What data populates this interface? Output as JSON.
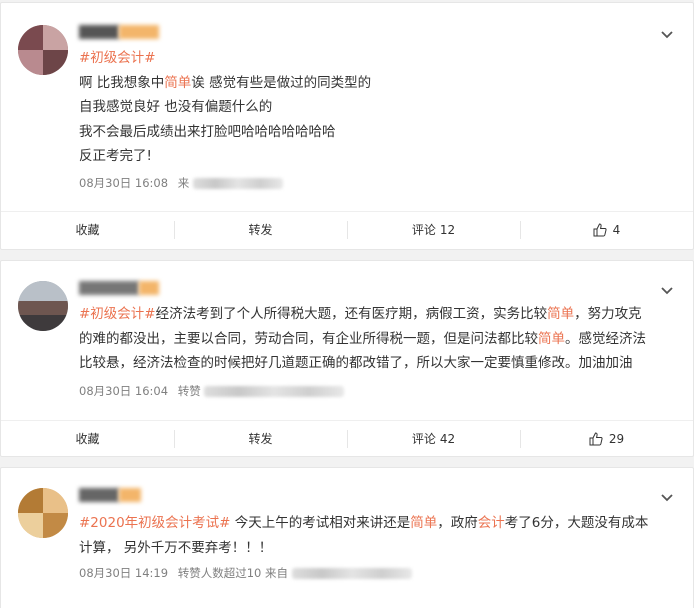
{
  "posts": [
    {
      "user": {
        "name": "",
        "avatar": "avatar-image"
      },
      "lines": [
        [
          {
            "t": "#初级会计#",
            "c": "tag"
          }
        ],
        [
          {
            "t": "啊 比我想象中"
          },
          {
            "t": "简单",
            "c": "hl"
          },
          {
            "t": "诶 感觉有些是做过的同类型的"
          }
        ],
        [
          {
            "t": "自我感觉良好 也没有偏题什么的"
          }
        ],
        [
          {
            "t": "我不会最后成绩出来打脸吧哈哈哈哈哈哈哈"
          }
        ],
        [
          {
            "t": "反正考完了!"
          }
        ]
      ],
      "time": "08月30日 16:08",
      "source_prefix": "来",
      "actions": {
        "collect": "收藏",
        "repost": "转发",
        "comment_label": "评论",
        "comment_count": "12",
        "like_count": "4"
      }
    },
    {
      "user": {
        "name": "",
        "avatar": "avatar-image"
      },
      "lines": [
        [
          {
            "t": "#初级会计#",
            "c": "tag"
          },
          {
            "t": "经济法考到了个人所得税大题，还有医疗期，病假工资，实务比较"
          },
          {
            "t": "简单",
            "c": "hl"
          },
          {
            "t": "，努力攻克"
          }
        ],
        [
          {
            "t": "的难的都没出，主要以合同，劳动合同，有企业所得税一题，但是问法都比较"
          },
          {
            "t": "简单",
            "c": "hl"
          },
          {
            "t": "。感觉经济法"
          }
        ],
        [
          {
            "t": "比较悬，经济法检查的时候把好几道题正确的都改错了，所以大家一定要慎重修改。加油加油"
          }
        ]
      ],
      "time": "08月30日 16:04",
      "source_prefix": "转赞",
      "actions": {
        "collect": "收藏",
        "repost": "转发",
        "comment_label": "评论",
        "comment_count": "42",
        "like_count": "29"
      }
    },
    {
      "user": {
        "name": "",
        "avatar": "avatar-image"
      },
      "lines": [
        [
          {
            "t": "#2020年初级会计考试#",
            "c": "tag"
          },
          {
            "t": " 今天上午的考试相对来讲还是"
          },
          {
            "t": "简单",
            "c": "hl"
          },
          {
            "t": "，政府"
          },
          {
            "t": "会计",
            "c": "hl"
          },
          {
            "t": "考了6分，大题没有成本"
          }
        ],
        [
          {
            "t": "计算， 另外千万不要弃考！！！"
          }
        ]
      ],
      "time": "08月30日 14:19",
      "source_prefix": "转赞人数超过10  来自",
      "actions": null
    }
  ],
  "colors": {
    "accent": "#eb7350",
    "text": "#333333",
    "meta": "#808080",
    "background": "#f2f2f2"
  },
  "icons": {
    "menu": "chevron-down-icon",
    "like": "thumbs-up-icon"
  }
}
